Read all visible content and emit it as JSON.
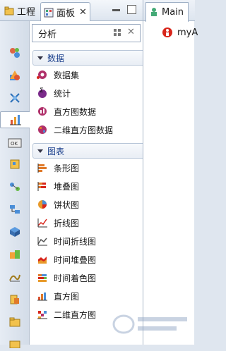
{
  "views": {
    "project_tab": {
      "label": "工程"
    },
    "palette_tab": {
      "label": "面板"
    }
  },
  "palette": {
    "title": "分析",
    "drawers": [
      {
        "label": "数据",
        "items": [
          "数据集",
          "统计",
          "直方图数据",
          "二维直方图数据"
        ]
      },
      {
        "label": "图表",
        "items": [
          "条形图",
          "堆叠图",
          "饼状图",
          "折线图",
          "时间折线图",
          "时间堆叠图",
          "时间着色图",
          "直方图",
          "二维直方图"
        ]
      }
    ]
  },
  "editor": {
    "tab_label": "Main",
    "item_label": "myA"
  },
  "icons": [
    "project-icon",
    "palette-icon",
    "close-icon",
    "minimize-icon",
    "maximize-icon",
    "layout-icon",
    "collapse-icon",
    "dataset-icon",
    "statistic-icon",
    "histogram-data-icon",
    "histogram2d-data-icon",
    "bar-chart-icon",
    "stacked-chart-icon",
    "pie-chart-icon",
    "line-chart-icon",
    "time-line-chart-icon",
    "time-stacked-chart-icon",
    "time-color-chart-icon",
    "histogram-icon",
    "histogram2d-icon",
    "agent-icon"
  ],
  "colors": {
    "accent": "#1a3f8c",
    "panel_border": "#9aaac0",
    "error_red": "#d8261b"
  }
}
